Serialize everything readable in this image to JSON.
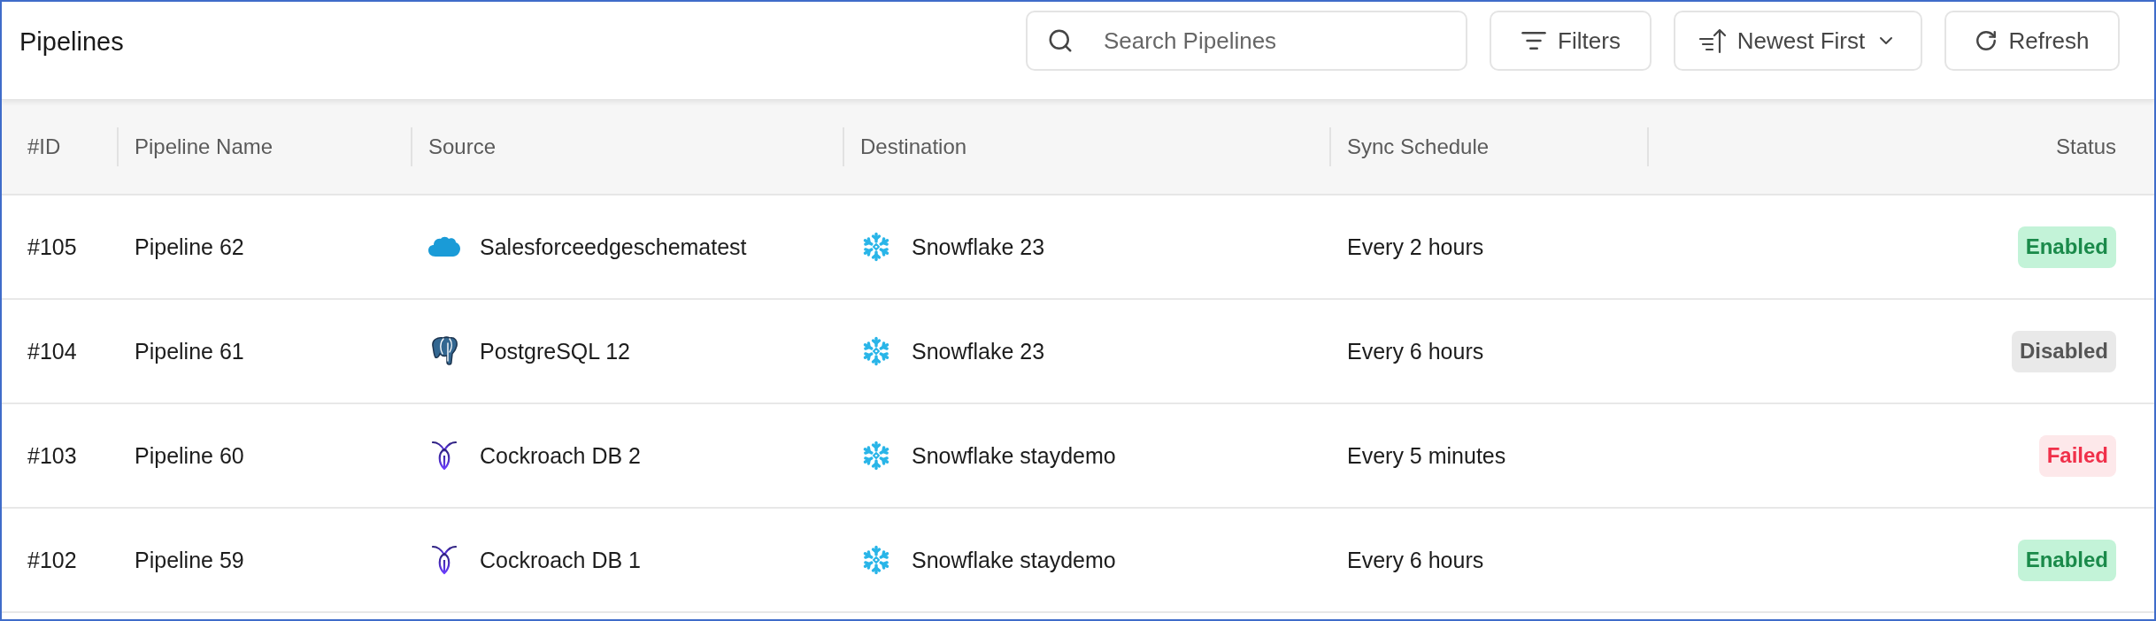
{
  "page": {
    "title": "Pipelines"
  },
  "toolbar": {
    "search": {
      "placeholder": "Search Pipelines"
    },
    "filters_button": "Filters",
    "sort_button": "Newest First",
    "refresh_button": "Refresh"
  },
  "table": {
    "columns": [
      "#ID",
      "Pipeline Name",
      "Source",
      "Destination",
      "Sync Schedule",
      "Status"
    ],
    "rows": [
      {
        "id": "#105",
        "name": "Pipeline 62",
        "source": {
          "name": "Salesforceedgeschematest",
          "kind": "salesforce"
        },
        "destination": {
          "name": "Snowflake 23",
          "kind": "snowflake"
        },
        "schedule": "Every 2 hours",
        "status": {
          "label": "Enabled",
          "kind": "enabled"
        }
      },
      {
        "id": "#104",
        "name": "Pipeline 61",
        "source": {
          "name": "PostgreSQL 12",
          "kind": "postgresql"
        },
        "destination": {
          "name": "Snowflake 23",
          "kind": "snowflake"
        },
        "schedule": "Every 6 hours",
        "status": {
          "label": "Disabled",
          "kind": "disabled"
        }
      },
      {
        "id": "#103",
        "name": "Pipeline 60",
        "source": {
          "name": "Cockroach DB 2",
          "kind": "cockroachdb"
        },
        "destination": {
          "name": "Snowflake staydemo",
          "kind": "snowflake"
        },
        "schedule": "Every 5 minutes",
        "status": {
          "label": "Failed",
          "kind": "failed"
        }
      },
      {
        "id": "#102",
        "name": "Pipeline 59",
        "source": {
          "name": "Cockroach DB 1",
          "kind": "cockroachdb"
        },
        "destination": {
          "name": "Snowflake staydemo",
          "kind": "snowflake"
        },
        "schedule": "Every 6 hours",
        "status": {
          "label": "Enabled",
          "kind": "enabled"
        }
      }
    ]
  }
}
